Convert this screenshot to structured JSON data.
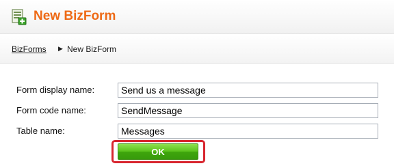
{
  "header": {
    "title": "New BizForm",
    "icon": "form-add-icon",
    "title_color": "#ee6a16"
  },
  "breadcrumb": {
    "parent": "BizForms",
    "current": "New BizForm",
    "separator_icon": "triangle-right-icon"
  },
  "form": {
    "display_name": {
      "label": "Form display name:",
      "value": "Send us a message"
    },
    "code_name": {
      "label": "Form code name:",
      "value": "SendMessage"
    },
    "table_name": {
      "label": "Table name:",
      "value": "Messages"
    }
  },
  "actions": {
    "ok_label": "OK",
    "ok_color": "#4fb516",
    "highlight_color": "#d8262f"
  }
}
